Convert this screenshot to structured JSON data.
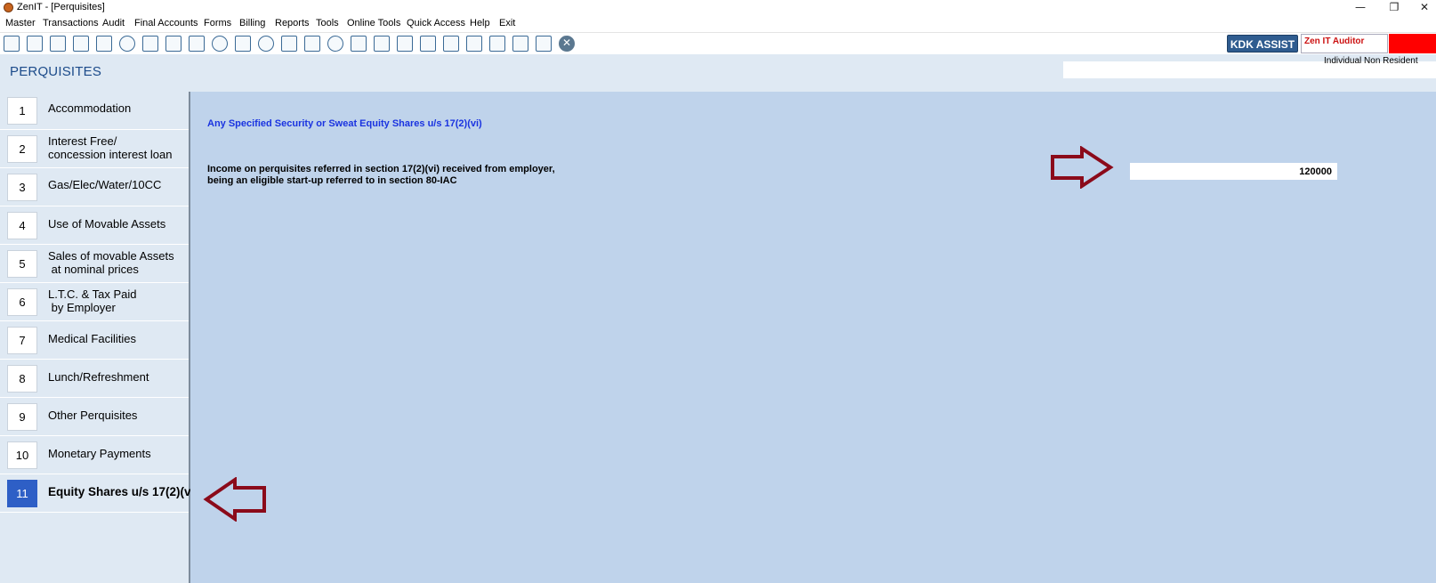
{
  "window": {
    "title": "ZenIT - [Perquisites]",
    "minimize": "—",
    "restore": "❐",
    "close": "✕"
  },
  "menu": [
    "Master",
    "Transactions",
    "Audit",
    "Final Accounts",
    "Forms",
    "Billing",
    "Reports",
    "Tools",
    "Online Tools",
    "Quick Access",
    "Help",
    "Exit"
  ],
  "toolbar": {
    "icons": [
      "rupee-icon",
      "home-icon",
      "building-icon",
      "bar-chart-icon",
      "gift-icon",
      "users-icon",
      "broom-icon",
      "filter-icon",
      "tax-icon",
      "eye-icon",
      "calculator-icon",
      "pie-chart-icon",
      "pay-icon",
      "book-icon",
      "info-icon",
      "report-icon",
      "user-doc-icon",
      "calendar-icon",
      "shield-icon",
      "search-doc-icon",
      "bs-doc-icon",
      "bs-folder-icon",
      "3cd-icon",
      "form-icon"
    ],
    "close_glyph": "✕",
    "kdk_assist": "KDK ASSIST",
    "zen_auditor": "Zen IT Auditor",
    "status": "Individual  Non Resident",
    "accent_red": "#ff0000"
  },
  "header": {
    "title": "PERQUISITES"
  },
  "sidebar": {
    "items": [
      {
        "num": "1",
        "label": "Accommodation"
      },
      {
        "num": "2",
        "label": "Interest Free/\nconcession interest loan"
      },
      {
        "num": "3",
        "label": "Gas/Elec/Water/10CC"
      },
      {
        "num": "4",
        "label": "Use of Movable Assets"
      },
      {
        "num": "5",
        "label": "Sales of movable Assets\n at nominal prices"
      },
      {
        "num": "6",
        "label": "L.T.C. & Tax Paid\n by Employer"
      },
      {
        "num": "7",
        "label": "Medical Facilities"
      },
      {
        "num": "8",
        "label": "Lunch/Refreshment"
      },
      {
        "num": "9",
        "label": "Other Perquisites"
      },
      {
        "num": "10",
        "label": "Monetary Payments"
      },
      {
        "num": "11",
        "label": "Equity Shares u/s 17(2)(v"
      }
    ],
    "active_index": 10,
    "active_color": "#2e5fc6"
  },
  "main": {
    "section_heading": "Any Specified Security or Sweat Equity Shares u/s 17(2)(vi)",
    "field_label": "Income on perquisites referred in section 17(2)(vi) received from employer, being an eligible start-up referred to in section 80-IAC",
    "amount_value": "120000",
    "arrow_color": "#8b0a1a"
  }
}
